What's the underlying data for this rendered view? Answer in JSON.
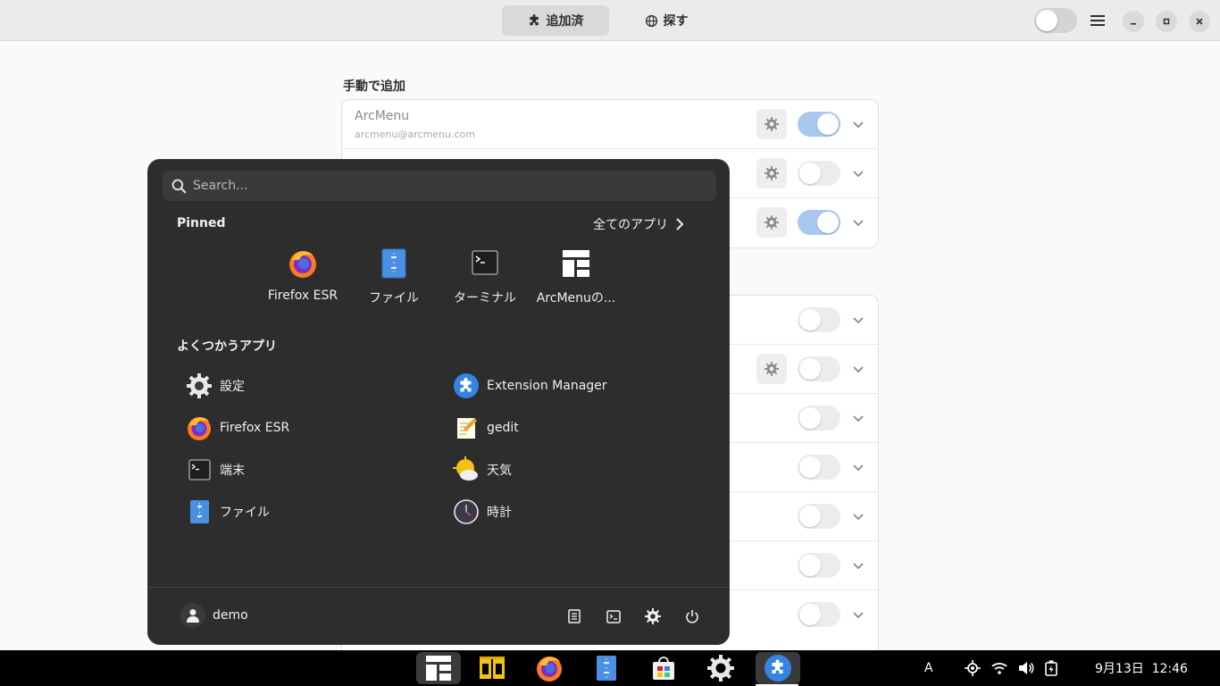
{
  "header": {
    "tabs": [
      {
        "label": "追加済",
        "icon": "puzzle-icon",
        "active": true
      },
      {
        "label": "探す",
        "icon": "globe-icon",
        "active": false
      }
    ]
  },
  "content": {
    "manual_section_title": "手動で追加",
    "manual_rows": [
      {
        "name": "ArcMenu",
        "sub": "arcmenu@arcmenu.com",
        "has_settings": true,
        "enabled": true
      },
      {
        "name": "",
        "sub": "",
        "has_settings": true,
        "enabled": false
      },
      {
        "name": "",
        "sub": "",
        "has_settings": true,
        "enabled": true
      }
    ],
    "system_rows": [
      {
        "has_settings": false,
        "enabled": false
      },
      {
        "has_settings": true,
        "enabled": false
      },
      {
        "has_settings": false,
        "enabled": false
      },
      {
        "has_settings": false,
        "enabled": false
      },
      {
        "has_settings": false,
        "enabled": false
      },
      {
        "has_settings": false,
        "enabled": false
      },
      {
        "has_settings": false,
        "enabled": false
      }
    ]
  },
  "arcmenu": {
    "search_placeholder": "Search...",
    "pinned_label": "Pinned",
    "all_apps_label": "全てのアプリ",
    "pinned": [
      {
        "label": "Firefox ESR",
        "icon": "firefox-icon"
      },
      {
        "label": "ファイル",
        "icon": "files-icon"
      },
      {
        "label": "ターミナル",
        "icon": "terminal-icon"
      },
      {
        "label": "ArcMenuの...",
        "icon": "arcmenu-icon"
      }
    ],
    "frequent_label": "よくつかうアプリ",
    "frequent": [
      {
        "label": "設定",
        "icon": "settings-icon"
      },
      {
        "label": "Extension Manager",
        "icon": "extension-manager-icon"
      },
      {
        "label": "Firefox ESR",
        "icon": "firefox-icon"
      },
      {
        "label": "gedit",
        "icon": "gedit-icon"
      },
      {
        "label": "端末",
        "icon": "terminal-icon"
      },
      {
        "label": "天気",
        "icon": "weather-icon"
      },
      {
        "label": "ファイル",
        "icon": "files-icon"
      },
      {
        "label": "時計",
        "icon": "clock-icon"
      }
    ],
    "user_name": "demo"
  },
  "taskbar": {
    "apps": [
      "arcmenu-icon",
      "books-icon",
      "firefox-icon",
      "files-icon",
      "software-icon",
      "settings-icon",
      "extension-manager-icon"
    ],
    "input_method": "A",
    "datetime": "9月13日  12:46"
  },
  "colors": {
    "accent": "#3584e4",
    "switch_on": "#a9c8ef",
    "menu_bg": "#2d2d2d"
  }
}
